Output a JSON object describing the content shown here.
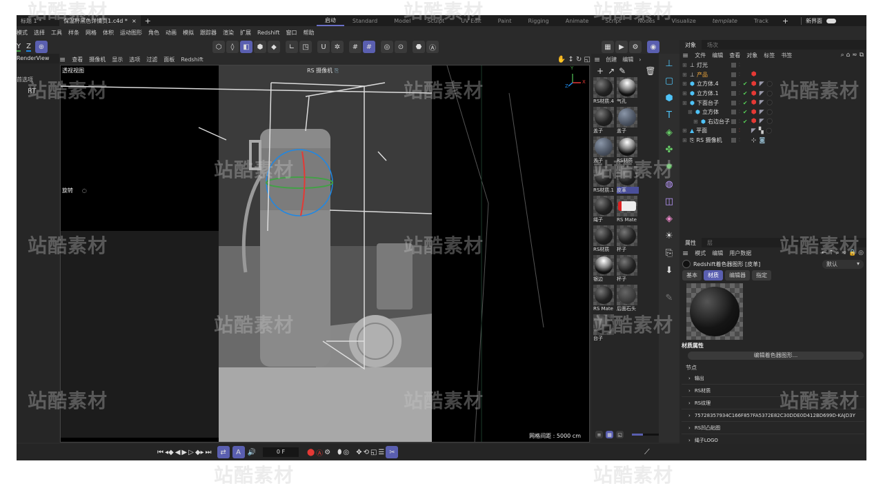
{
  "tabs": {
    "docs": [
      {
        "label": "标题 1 *"
      },
      {
        "label": "保温杯黑色详情页1.c4d *",
        "active": true
      }
    ],
    "add": "+",
    "close": "×"
  },
  "workspaces": [
    "启动",
    "Standard",
    "Model",
    "Sculpt",
    "UV Edit",
    "Paint",
    "Rigging",
    "Animate",
    "Script",
    "Nodes",
    "Visualize",
    "template",
    "Track"
  ],
  "workspace_active": "启动",
  "add_workspace": "+",
  "new_ui_label": "新界面",
  "menu": [
    "模式",
    "选择",
    "工具",
    "样条",
    "网格",
    "体积",
    "运动图形",
    "角色",
    "动画",
    "模拟",
    "跟踪器",
    "渲染",
    "扩展",
    "Redshift",
    "窗口",
    "帮助"
  ],
  "axes": {
    "y": "Y",
    "z": "Z"
  },
  "left_panel": {
    "title": "RenderView",
    "option": "首选项",
    "rt": "RT"
  },
  "viewport": {
    "menu": [
      "查看",
      "摄像机",
      "显示",
      "选项",
      "过滤",
      "面板",
      "Redshift"
    ],
    "view_name": "透视视图",
    "camera": "RS 摄像机",
    "rotate_label": "旋转",
    "grid": "网格间距 : 5000 cm",
    "axis_labels": {
      "x": "X",
      "y": "Y",
      "z": "Z"
    }
  },
  "materials": {
    "menu": [
      "创建",
      "编辑"
    ],
    "items": [
      {
        "name": "RS材质.4",
        "style": "dark"
      },
      {
        "name": "气孔",
        "style": "chrome"
      },
      {
        "name": "盖子",
        "style": "dark"
      },
      {
        "name": "盖子",
        "style": "blue"
      },
      {
        "name": "盖子",
        "style": "blue"
      },
      {
        "name": "RS材质",
        "style": "chrome"
      },
      {
        "name": "RS材质.1",
        "style": "dark"
      },
      {
        "name": "皮革",
        "style": "dark",
        "selected": true
      },
      {
        "name": "绳子",
        "style": "dark"
      },
      {
        "name": "RS Mate",
        "style": "tex"
      },
      {
        "name": "RS材质",
        "style": "dark"
      },
      {
        "name": "杯子",
        "style": "dark"
      },
      {
        "name": "银边",
        "style": "chrome"
      },
      {
        "name": "杯子",
        "style": "dark"
      },
      {
        "name": "RS Mate",
        "style": "dark"
      },
      {
        "name": "后面石头",
        "style": "stone"
      },
      {
        "name": "台子",
        "style": "dark"
      }
    ]
  },
  "objects": {
    "tabs": [
      "对象",
      "场次"
    ],
    "menu": [
      "文件",
      "编辑",
      "查看",
      "对象",
      "标签",
      "书签"
    ],
    "items": [
      {
        "name": "灯光",
        "depth": 0,
        "icon": "null",
        "check": false,
        "tags": []
      },
      {
        "name": "产品",
        "depth": 0,
        "icon": "null",
        "check": false,
        "tags": [
          "red"
        ],
        "highlight": true
      },
      {
        "name": "立方体.4",
        "depth": 0,
        "icon": "cube",
        "check": true,
        "tags": [
          "red",
          "uv",
          "mat"
        ]
      },
      {
        "name": "立方体.1",
        "depth": 0,
        "icon": "cube",
        "check": true,
        "tags": [
          "red",
          "uv",
          "mat"
        ]
      },
      {
        "name": "下面台子",
        "depth": 0,
        "icon": "cube",
        "check": true,
        "tags": [
          "red",
          "uv",
          "mat"
        ]
      },
      {
        "name": "立方体",
        "depth": 1,
        "icon": "cube",
        "check": true,
        "tags": [
          "red",
          "uv",
          "mat"
        ]
      },
      {
        "name": "右边台子",
        "depth": 2,
        "icon": "cube",
        "check": true,
        "tags": [
          "red",
          "uv",
          "mat"
        ]
      },
      {
        "name": "平面",
        "depth": 0,
        "icon": "plane",
        "check": false,
        "tags": [
          "uv",
          "checker",
          "mat"
        ]
      },
      {
        "name": "RS 摄像机",
        "depth": 0,
        "icon": "camera",
        "check": false,
        "tags": [
          "target",
          "cam"
        ]
      }
    ]
  },
  "attributes": {
    "tabs": [
      "属性",
      "层"
    ],
    "menu": [
      "模式",
      "编辑",
      "用户数据"
    ],
    "title": "Redshift着色器图形 [皮革]",
    "preset": "默认",
    "subtabs": [
      "基本",
      "材质",
      "编辑器",
      "指定"
    ],
    "subtab_active": "材质",
    "section": "材质属性",
    "edit_button": "编辑着色器图形...",
    "nodes_label": "节点",
    "nodes": [
      "输出",
      "RS材质",
      "RS纹理",
      "75728357934C166F857FA5372E82C30DDE0D412BD699D-KAJD3Y",
      "RS凹凸贴图",
      "绳子LOGO"
    ]
  },
  "timeline": {
    "frame": "0 F"
  },
  "watermark": "站酷素材",
  "colors": {
    "accent": "#5a5fb0",
    "bg": "#2a2a2a",
    "highlight": "#e8a23a",
    "x_axis": "#e53935",
    "y_axis": "#43a047",
    "z_axis": "#1e88e5"
  }
}
